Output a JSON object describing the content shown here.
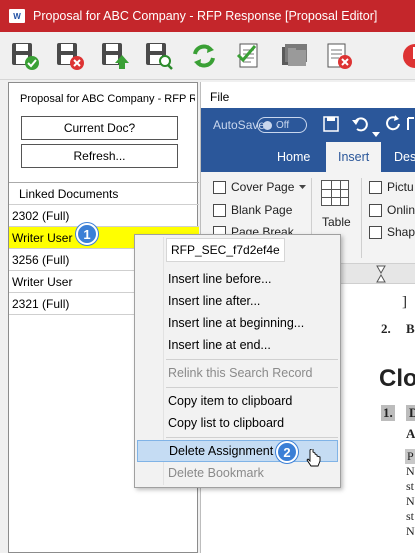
{
  "window": {
    "app_icon_text": "W",
    "title": "Proposal for ABC Company - RFP Response [Proposal Editor]"
  },
  "toolbar": {
    "buttons": [
      {
        "icon": "save-check-icon"
      },
      {
        "icon": "save-cancel-icon"
      },
      {
        "icon": "save-upload-icon"
      },
      {
        "icon": "save-search-icon"
      },
      {
        "icon": "refresh-icon"
      },
      {
        "icon": "document-check-icon"
      },
      {
        "icon": "folder-stack-icon"
      },
      {
        "icon": "document-cancel-icon"
      },
      {
        "icon": "close-app-icon"
      }
    ]
  },
  "left_panel": {
    "doc_title": "Proposal for ABC Company - RFP Res",
    "current_doc_label": "Current Doc?",
    "refresh_label": "Refresh...",
    "list_header": "Linked Documents",
    "items": [
      "2302 (Full)",
      "Writer User",
      "3256 (Full)",
      "Writer User",
      "2321 (Full)"
    ],
    "selected_index": 1
  },
  "callouts": {
    "first": "1",
    "second": "2"
  },
  "word": {
    "file_tab": "File",
    "autosave_label": "AutoSave",
    "autosave_state": "Off",
    "tabs": [
      "Home",
      "Insert",
      "Desi"
    ],
    "active_tab": "Insert",
    "ribbon": {
      "cover_page": "Cover Page",
      "blank_page": "Blank Page",
      "page_break": "Page Break",
      "table": "Table",
      "pictures": "Pictu",
      "online": "Onlin",
      "shapes": "Shape",
      "pages_group": "es"
    },
    "doc_lines": {
      "bracket": "]",
      "item2_num": "2.",
      "item2_text": "B",
      "heading": "Clo",
      "item1_num": "1.",
      "item1_text": "D",
      "sub_a": "A",
      "p_line": "P",
      "n_line1": "N",
      "s_line1": "st",
      "n_line2": "N",
      "s_line2": "st",
      "n_line3": "N"
    }
  },
  "context_menu": {
    "header": "RFP_SEC_f7d2ef4e",
    "items": [
      {
        "label": "Insert line before...",
        "enabled": true
      },
      {
        "label": "Insert line after...",
        "enabled": true
      },
      {
        "label": "Insert line at beginning...",
        "enabled": true
      },
      {
        "label": "Insert line at end...",
        "enabled": true
      },
      {
        "label": "Relink this Search Record",
        "enabled": false
      },
      {
        "label": "Copy item to clipboard",
        "enabled": true
      },
      {
        "label": "Copy list to clipboard",
        "enabled": true
      },
      {
        "label": "Delete Assignment",
        "enabled": true,
        "highlighted": true
      },
      {
        "label": "Delete Bookmark",
        "enabled": false
      }
    ]
  },
  "colors": {
    "titlebar": "#c4262b",
    "word_blue": "#2b579a",
    "selection_yellow": "#ffff00",
    "callout_blue": "#3b7fd6",
    "menu_highlight": "#c5dcf3"
  }
}
